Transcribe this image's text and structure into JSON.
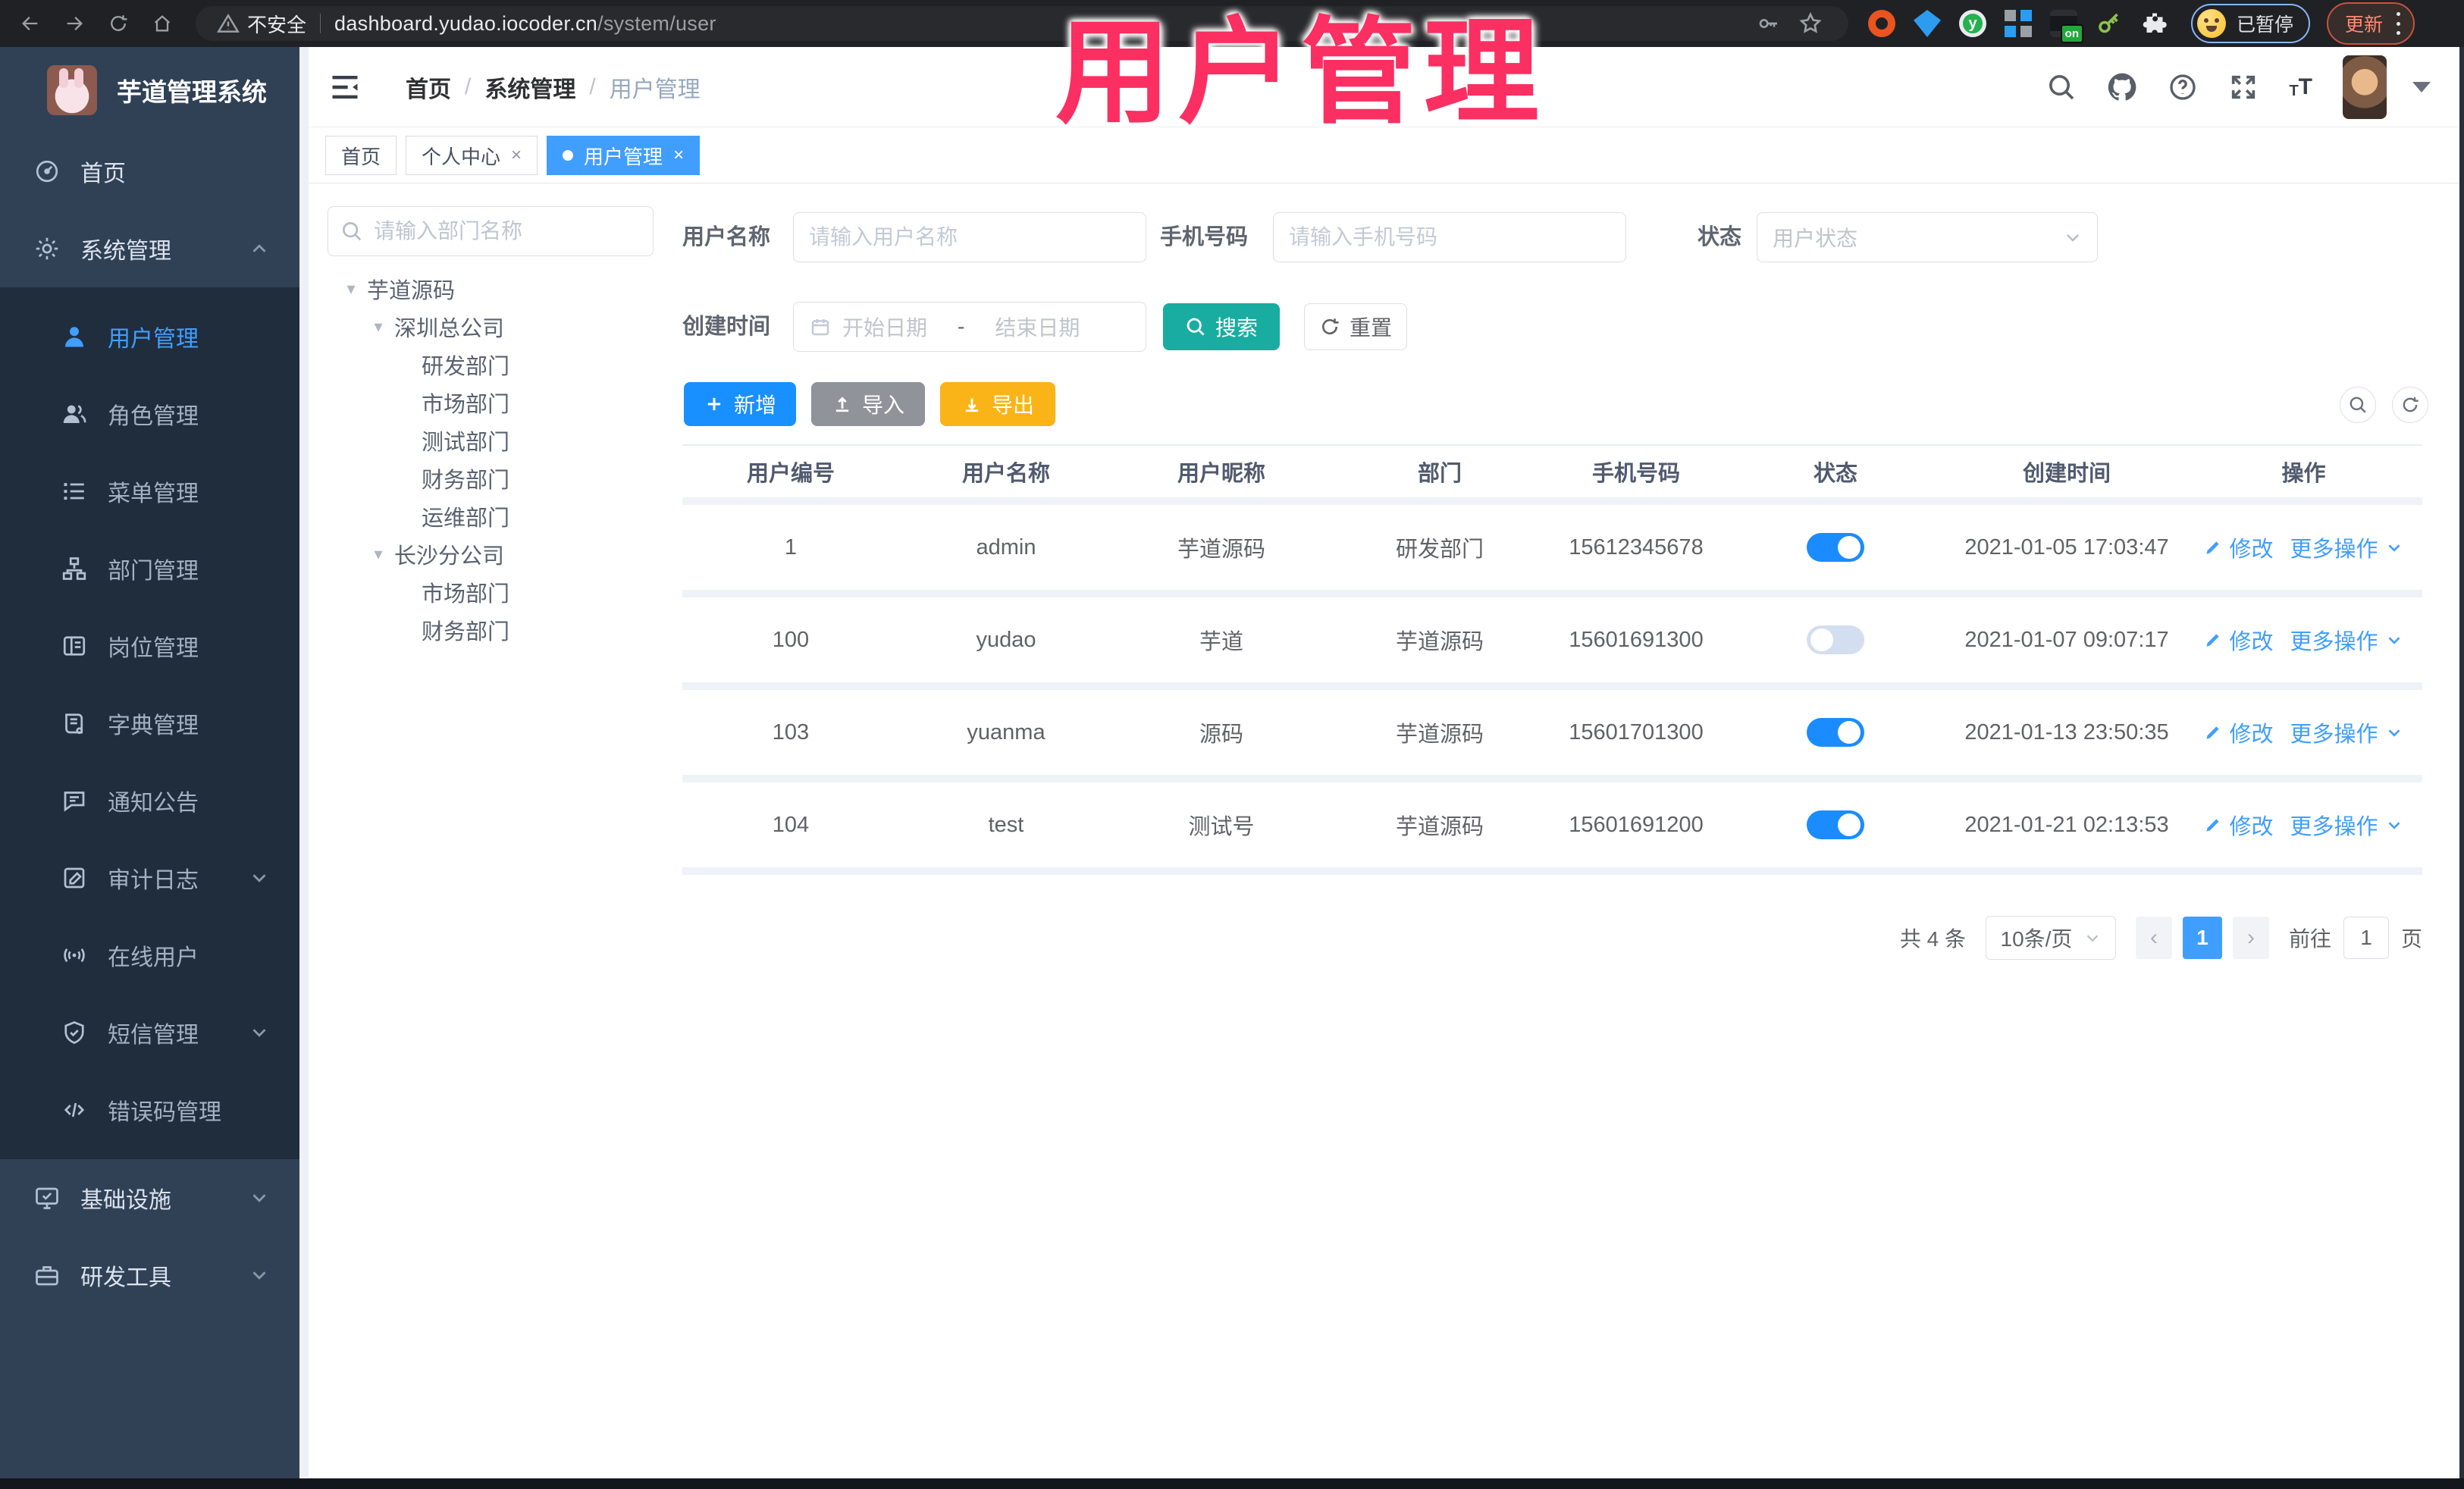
{
  "browser": {
    "security_label": "不安全",
    "url_host": "dashboard.yudao.iocoder.cn",
    "url_path": "/system/user",
    "profile_status": "已暂停",
    "update_label": "更新",
    "extension_badge": "on"
  },
  "watermark": {
    "text": "用户管理"
  },
  "sidebar": {
    "logo_title": "芋道管理系统",
    "items": [
      {
        "label": "首页",
        "icon": "home-icon",
        "level": "top"
      },
      {
        "label": "系统管理",
        "icon": "gear-icon",
        "level": "top",
        "chevron": "up"
      },
      {
        "label": "用户管理",
        "icon": "user-icon",
        "level": "sub",
        "active": true
      },
      {
        "label": "角色管理",
        "icon": "users-icon",
        "level": "sub"
      },
      {
        "label": "菜单管理",
        "icon": "menu-list-icon",
        "level": "sub"
      },
      {
        "label": "部门管理",
        "icon": "org-chart-icon",
        "level": "sub"
      },
      {
        "label": "岗位管理",
        "icon": "id-card-icon",
        "level": "sub"
      },
      {
        "label": "字典管理",
        "icon": "dictionary-icon",
        "level": "sub"
      },
      {
        "label": "通知公告",
        "icon": "announcement-icon",
        "level": "sub"
      },
      {
        "label": "审计日志",
        "icon": "audit-log-icon",
        "level": "sub",
        "chevron": "down"
      },
      {
        "label": "在线用户",
        "icon": "online-user-icon",
        "level": "sub"
      },
      {
        "label": "短信管理",
        "icon": "sms-shield-icon",
        "level": "sub",
        "chevron": "down"
      },
      {
        "label": "错误码管理",
        "icon": "error-code-icon",
        "level": "sub"
      },
      {
        "label": "基础设施",
        "icon": "infrastructure-icon",
        "level": "top",
        "chevron": "down"
      },
      {
        "label": "研发工具",
        "icon": "dev-tools-icon",
        "level": "top",
        "chevron": "down"
      }
    ]
  },
  "header": {
    "breadcrumb": [
      "首页",
      "系统管理",
      "用户管理"
    ]
  },
  "tabs": [
    {
      "label": "首页"
    },
    {
      "label": "个人中心",
      "closable": true
    },
    {
      "label": "用户管理",
      "closable": true,
      "active": true
    }
  ],
  "dept_panel": {
    "search_placeholder": "请输入部门名称",
    "tree": [
      {
        "label": "芋道源码",
        "indent": 0,
        "caret": true
      },
      {
        "label": "深圳总公司",
        "indent": 1,
        "caret": true
      },
      {
        "label": "研发部门",
        "indent": 2
      },
      {
        "label": "市场部门",
        "indent": 2
      },
      {
        "label": "测试部门",
        "indent": 2
      },
      {
        "label": "财务部门",
        "indent": 2
      },
      {
        "label": "运维部门",
        "indent": 2
      },
      {
        "label": "长沙分公司",
        "indent": 1,
        "caret": true
      },
      {
        "label": "市场部门",
        "indent": 2
      },
      {
        "label": "财务部门",
        "indent": 2
      }
    ]
  },
  "filters": {
    "username_label": "用户名称",
    "username_placeholder": "请输入用户名称",
    "mobile_label": "手机号码",
    "mobile_placeholder": "请输入手机号码",
    "status_label": "状态",
    "status_placeholder": "用户状态",
    "create_time_label": "创建时间",
    "start_placeholder": "开始日期",
    "range_separator": "-",
    "end_placeholder": "结束日期",
    "search_label": "搜索",
    "reset_label": "重置"
  },
  "toolbar": {
    "add_label": "新增",
    "import_label": "导入",
    "export_label": "导出"
  },
  "table": {
    "columns": [
      "用户编号",
      "用户名称",
      "用户昵称",
      "部门",
      "手机号码",
      "状态",
      "创建时间",
      "操作"
    ],
    "edit_label": "修改",
    "more_label": "更多操作",
    "rows": [
      {
        "id": "1",
        "username": "admin",
        "nickname": "芋道源码",
        "dept": "研发部门",
        "mobile": "15612345678",
        "status": true,
        "create_time": "2021-01-05 17:03:47"
      },
      {
        "id": "100",
        "username": "yudao",
        "nickname": "芋道",
        "dept": "芋道源码",
        "mobile": "15601691300",
        "status": false,
        "create_time": "2021-01-07 09:07:17"
      },
      {
        "id": "103",
        "username": "yuanma",
        "nickname": "源码",
        "dept": "芋道源码",
        "mobile": "15601701300",
        "status": true,
        "create_time": "2021-01-13 23:50:35"
      },
      {
        "id": "104",
        "username": "test",
        "nickname": "测试号",
        "dept": "芋道源码",
        "mobile": "15601691200",
        "status": true,
        "create_time": "2021-01-21 02:13:53"
      }
    ]
  },
  "pagination": {
    "total_text": "共 4 条",
    "page_size": "10条/页",
    "current_page": "1",
    "prev_icon": "‹",
    "next_icon": "›",
    "goto_label": "前往",
    "goto_value": "1",
    "page_unit": "页"
  },
  "colors": {
    "primary": "#409eff",
    "search_teal": "#18ada0",
    "export_amber": "#fbb417",
    "import_gray": "#909399",
    "add_blue": "#1890ff",
    "sidebar_bg": "#304156",
    "submenu_bg": "#1f2d3d",
    "watermark_pink": "#fb2f61",
    "toggle_on": "#1a8cff"
  }
}
